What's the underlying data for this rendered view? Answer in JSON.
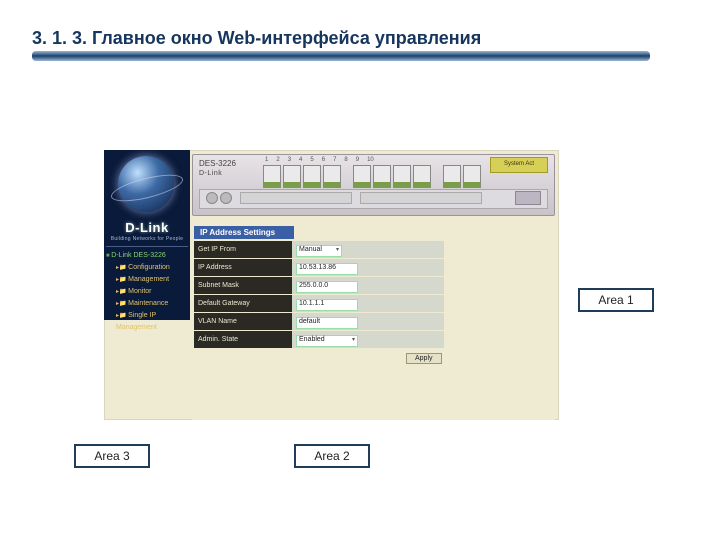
{
  "slide": {
    "title": "3. 1. 3. Главное окно Web-интерфейса управления"
  },
  "callouts": {
    "area1": "Area 1",
    "area2": "Area 2",
    "area3": "Area 3"
  },
  "device": {
    "model": "DES-3226",
    "brand": "D-Link",
    "system_box": "System Act",
    "port_numbers": [
      "1",
      "2",
      "3",
      "4",
      "5",
      "6",
      "7",
      "8",
      "9",
      "10"
    ]
  },
  "sidebar": {
    "brand": "D-Link",
    "brand_sub": "Building Networks for People",
    "root": "D-Link DES-3226",
    "items": [
      {
        "label": "Configuration"
      },
      {
        "label": "Management"
      },
      {
        "label": "Monitor"
      },
      {
        "label": "Maintenance"
      },
      {
        "label": "Single IP Management"
      }
    ]
  },
  "form": {
    "section_title": "IP Address Settings",
    "rows": [
      {
        "label": "Get IP From",
        "value": "Manual",
        "kind": "select"
      },
      {
        "label": "IP Address",
        "value": "10.53.13.86",
        "kind": "text"
      },
      {
        "label": "Subnet Mask",
        "value": "255.0.0.0",
        "kind": "text"
      },
      {
        "label": "Default Gateway",
        "value": "10.1.1.1",
        "kind": "text"
      },
      {
        "label": "VLAN Name",
        "value": "default",
        "kind": "text"
      },
      {
        "label": "Admin. State",
        "value": "Enabled",
        "kind": "select"
      }
    ],
    "apply": "Apply"
  }
}
